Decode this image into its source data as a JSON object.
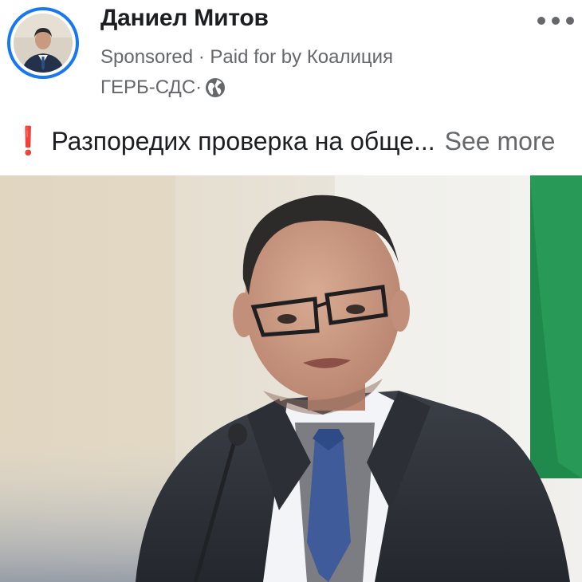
{
  "post": {
    "author_name": "Даниел Митов",
    "sponsored_label": "Sponsored",
    "meta_separator": " · ",
    "paid_for_line1": "Paid for by Коалиция",
    "paid_for_line2": "ГЕРБ-СДС",
    "privacy_icon": "globe-icon",
    "more_icon": "more-options-icon",
    "exclamation": "❗",
    "text": "Разпоредих проверка на обще...",
    "see_more": "See more"
  },
  "colors": {
    "accent": "#1877f2",
    "text_primary": "#1c1e21",
    "text_secondary": "#65676b",
    "flag_green": "#1f8a4c"
  }
}
